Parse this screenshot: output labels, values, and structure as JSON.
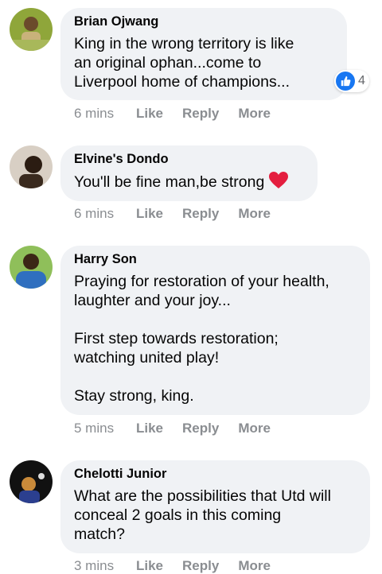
{
  "comments": [
    {
      "author": "Brian Ojwang",
      "text": "King in the wrong territory is like\nan original ophan...come to\nLiverpool home of champions...",
      "time": "6 mins",
      "like": "Like",
      "reply": "Reply",
      "more": "More",
      "reaction_count": "4"
    },
    {
      "author": "Elvine's Dondo",
      "text": "You'll be fine man,be strong",
      "time": "6 mins",
      "like": "Like",
      "reply": "Reply",
      "more": "More"
    },
    {
      "author": "Harry Son",
      "text": "Praying for restoration of your health,\nlaughter and your joy...\n\nFirst step towards restoration;\nwatching united play!\n\nStay strong, king.",
      "time": "5 mins",
      "like": "Like",
      "reply": "Reply",
      "more": "More"
    },
    {
      "author": "Chelotti Junior",
      "text": "What are the possibilities that Utd will\nconceal 2 goals in this coming\nmatch?",
      "time": "3 mins",
      "like": "Like",
      "reply": "Reply",
      "more": "More"
    }
  ],
  "colors": {
    "bubble": "#f0f2f5",
    "like_blue": "#1877f2",
    "heart": "#e41e3f",
    "meta": "#8a8d91"
  },
  "icons": [
    "like-icon",
    "heart-icon"
  ]
}
